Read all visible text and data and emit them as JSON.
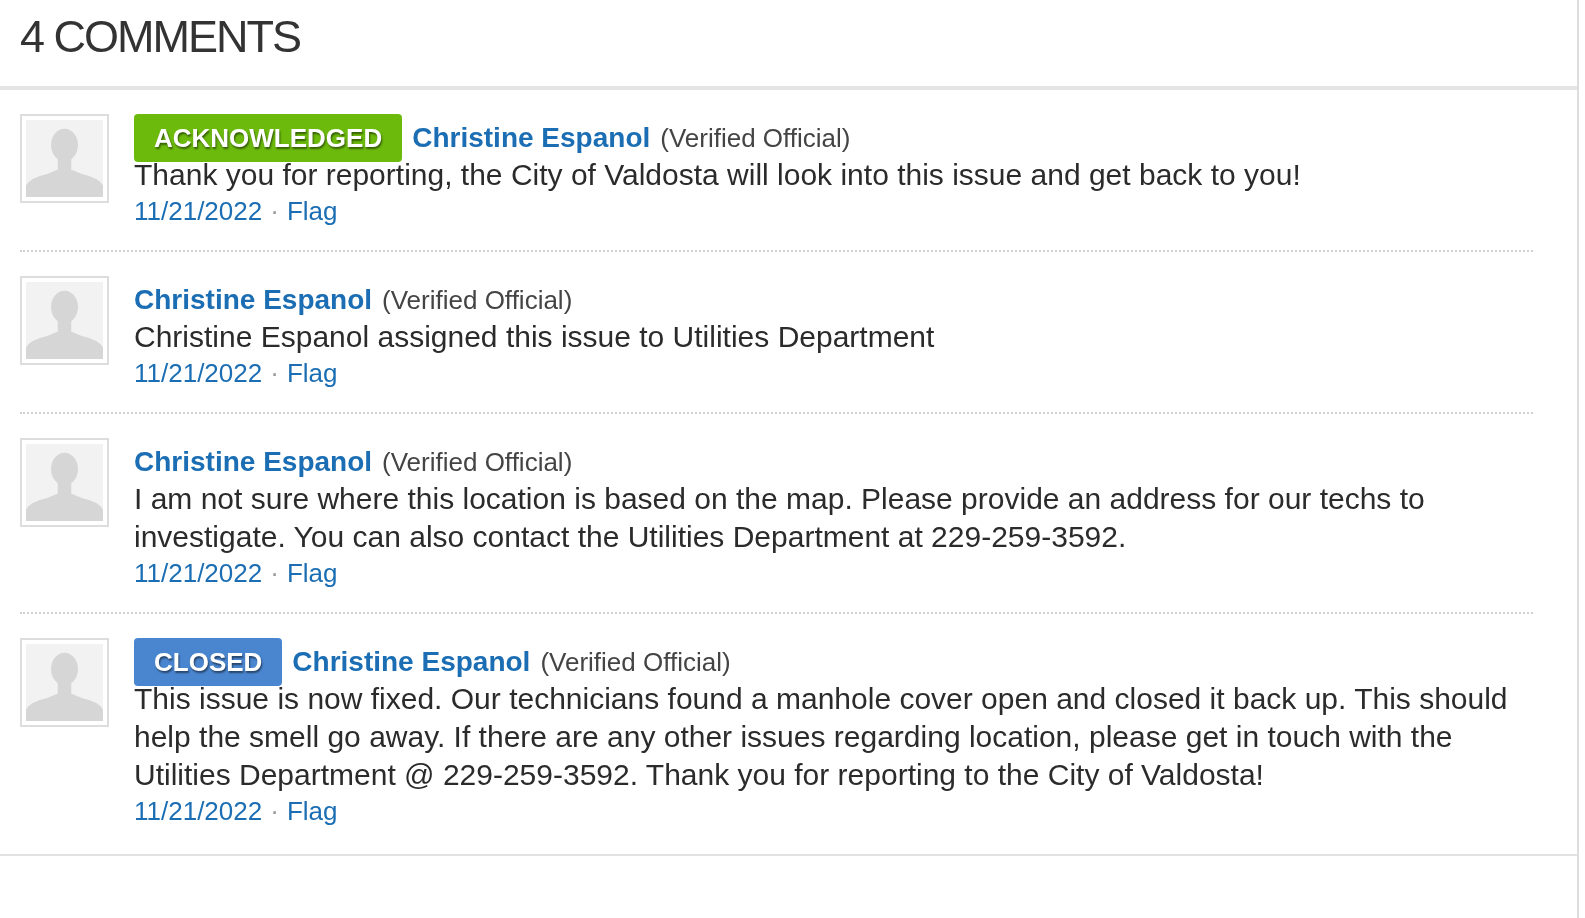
{
  "heading": "4 COMMENTS",
  "comments": [
    {
      "badge": {
        "kind": "acknowledged",
        "label": "ACKNOWLEDGED"
      },
      "author": "Christine Espanol",
      "role": "(Verified Official)",
      "text": "Thank you for reporting, the City of Valdosta will look into this issue and get back to you!",
      "date": "11/21/2022",
      "separator": "·",
      "flag": "Flag"
    },
    {
      "author": "Christine Espanol",
      "role": "(Verified Official)",
      "text": "Christine Espanol assigned this issue to Utilities Department",
      "date": "11/21/2022",
      "separator": "·",
      "flag": "Flag"
    },
    {
      "author": "Christine Espanol",
      "role": "(Verified Official)",
      "text": "I am not sure where this location is based on the map. Please provide an address for our techs to investigate. You can also contact the Utilities Department at 229-259-3592.",
      "date": "11/21/2022",
      "separator": "·",
      "flag": "Flag"
    },
    {
      "badge": {
        "kind": "closed",
        "label": "CLOSED"
      },
      "author": "Christine Espanol",
      "role": "(Verified Official)",
      "text": "This issue is now fixed. Our technicians found a manhole cover open and closed it back up. This should help the smell go away. If there are any other issues regarding location, please get in touch with the Utilities Department @ 229-259-3592. Thank you for reporting to the City of Valdosta!",
      "date": "11/21/2022",
      "separator": "·",
      "flag": "Flag"
    }
  ]
}
